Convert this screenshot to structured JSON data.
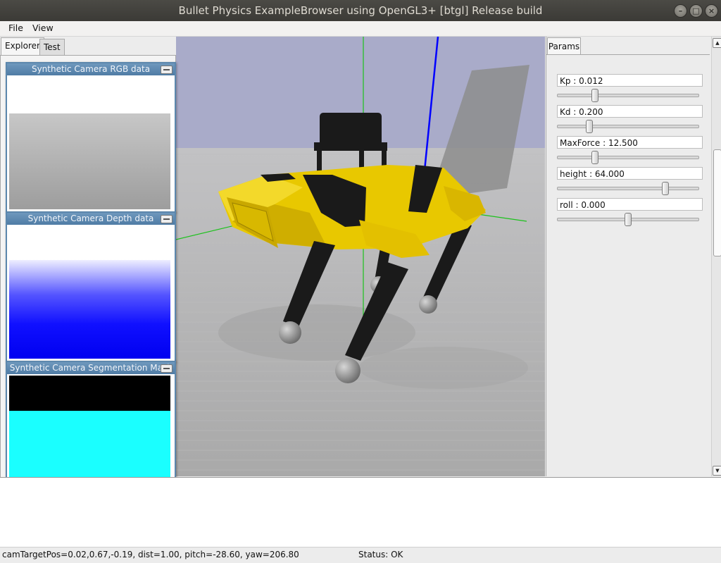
{
  "window": {
    "title": "Bullet Physics ExampleBrowser using OpenGL3+ [btgl] Release build",
    "buttons": [
      "minimize",
      "maximize",
      "close"
    ]
  },
  "menu": {
    "items": [
      "File",
      "View"
    ]
  },
  "explorer": {
    "tabs": [
      "Explorer",
      "Test"
    ],
    "active_tab": "Explorer",
    "cameras": [
      {
        "title": "Synthetic Camera RGB data",
        "icon": "minimize-icon"
      },
      {
        "title": "Synthetic Camera Depth data",
        "icon": "minimize-icon"
      },
      {
        "title": "Synthetic Camera Segmentation Mask",
        "icon": "minimize-icon"
      }
    ]
  },
  "params": {
    "tab": "Params",
    "items": [
      {
        "label": "Kp : 0.012",
        "slider": 0.25
      },
      {
        "label": "Kd : 0.200",
        "slider": 0.21
      },
      {
        "label": "MaxForce : 12.500",
        "slider": 0.25
      },
      {
        "label": "height : 64.000",
        "slider": 0.78
      },
      {
        "label": "roll : 0.000",
        "slider": 0.5
      }
    ]
  },
  "status": {
    "camera": "camTargetPos=0.02,0.67,-0.19, dist=1.00, pitch=-28.60, yaw=206.80",
    "state": "Status: OK"
  },
  "colors": {
    "robot_body": "#e8c800",
    "robot_dark": "#1a1a1a",
    "sky": "#a9abc9",
    "floor": "#b7b7b7",
    "depth": "#0000ff",
    "segmentation": "#1affff",
    "panel_header": "#5a86ad"
  }
}
